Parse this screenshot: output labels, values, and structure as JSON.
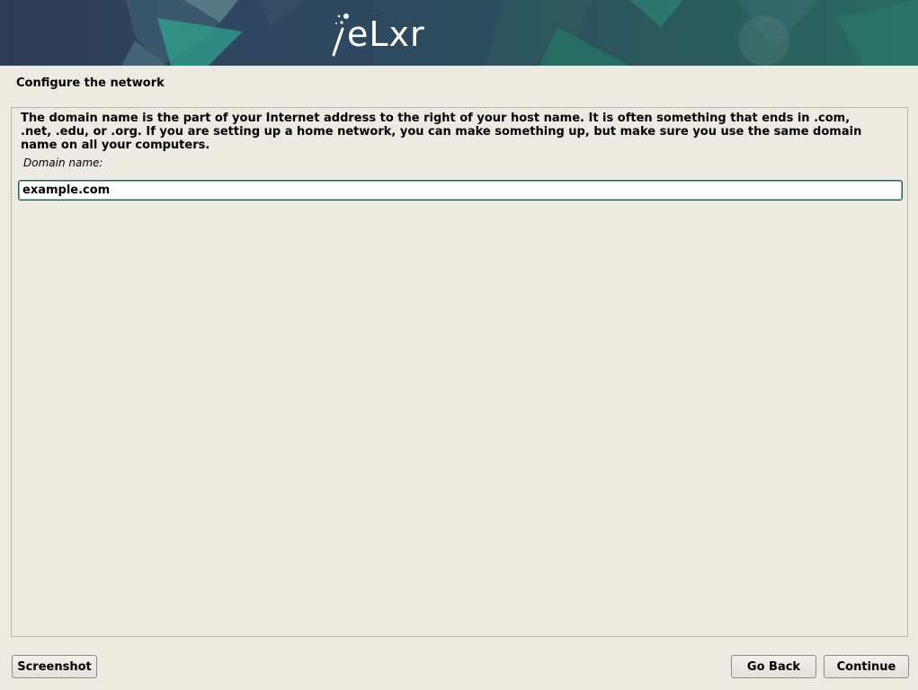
{
  "banner": {
    "logo_text": "eLxr",
    "logo_icon": "test-tube-sparkle-icon",
    "colors": {
      "background_left": "#2f3c55",
      "background_right": "#2a6c62",
      "accent_teal": "#2ea78e"
    }
  },
  "page": {
    "title": "Configure the network"
  },
  "main": {
    "description": "The domain name is the part of your Internet address to the right of your host name.  It is often something that ends in .com, .net, .edu, or .org.  If you are setting up a home network, you can make something up, but make sure you use the same domain name on all your computers.",
    "field_label": "Domain name:",
    "domain_value": "example.com"
  },
  "buttons": {
    "screenshot": "Screenshot",
    "go_back": "Go Back",
    "continue": "Continue"
  }
}
